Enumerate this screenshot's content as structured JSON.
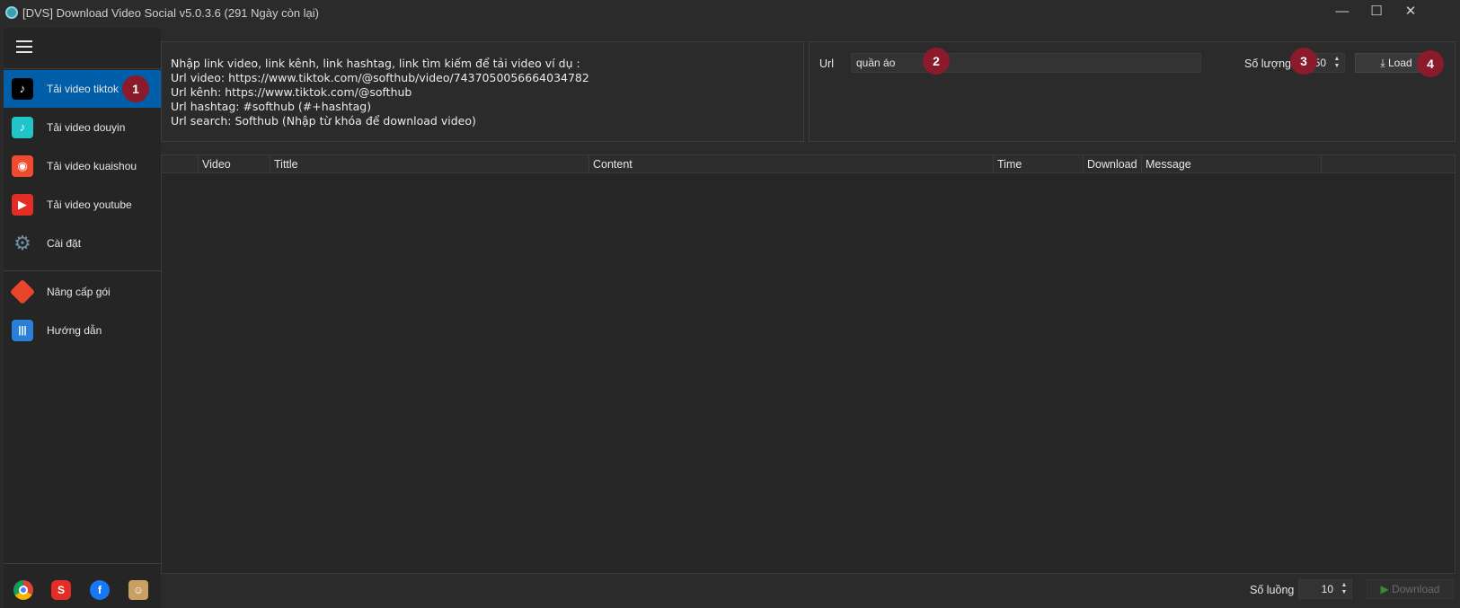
{
  "window": {
    "title": "[DVS] Download Video Social v5.0.3.6 (291 Ngày còn lại)",
    "controls": {
      "minimize": "—",
      "maximize": "☐",
      "close": "✕"
    }
  },
  "sidebar": {
    "items": [
      {
        "label": "Tải video tiktok",
        "icon": "tiktok-icon",
        "active": true
      },
      {
        "label": "Tải video douyin",
        "icon": "douyin-icon"
      },
      {
        "label": "Tải video kuaishou",
        "icon": "kuaishou-icon"
      },
      {
        "label": "Tải video youtube",
        "icon": "youtube-icon"
      },
      {
        "label": "Cài đặt",
        "icon": "gear-icon"
      },
      {
        "label": "Nâng cấp gói",
        "icon": "tag-icon"
      },
      {
        "label": "Hướng dẫn",
        "icon": "guide-icon"
      }
    ],
    "footer_icons": [
      "chrome-icon",
      "youtube-shorts-icon",
      "facebook-icon",
      "support-agent-icon"
    ]
  },
  "info": {
    "lines": [
      "Nhập link video, link kênh, link hashtag, link tìm kiếm để tải video ví dụ :",
      "Url video: https://www.tiktok.com/@softhub/video/7437050056664034782",
      "Url kênh: https://www.tiktok.com/@softhub",
      "Url hashtag: #softhub (#+hashtag)",
      "Url search: Softhub (Nhập từ khóa để download video)"
    ]
  },
  "form": {
    "url_label": "Url",
    "url_value": "quần áo",
    "quantity_label": "Số lượng",
    "quantity_value": "50",
    "load_label": "Load"
  },
  "badges": [
    "1",
    "2",
    "3",
    "4"
  ],
  "table": {
    "columns": [
      "Video",
      "Tittle",
      "Content",
      "Time",
      "Download",
      "Message"
    ]
  },
  "bottom": {
    "quantity_label": "Số luồng",
    "quantity_value": "10",
    "download_label": "Download"
  },
  "colors": {
    "background": "#2b2b2b",
    "sidebar": "#252526",
    "active": "#005fa8",
    "badge": "#8b1a2a"
  }
}
